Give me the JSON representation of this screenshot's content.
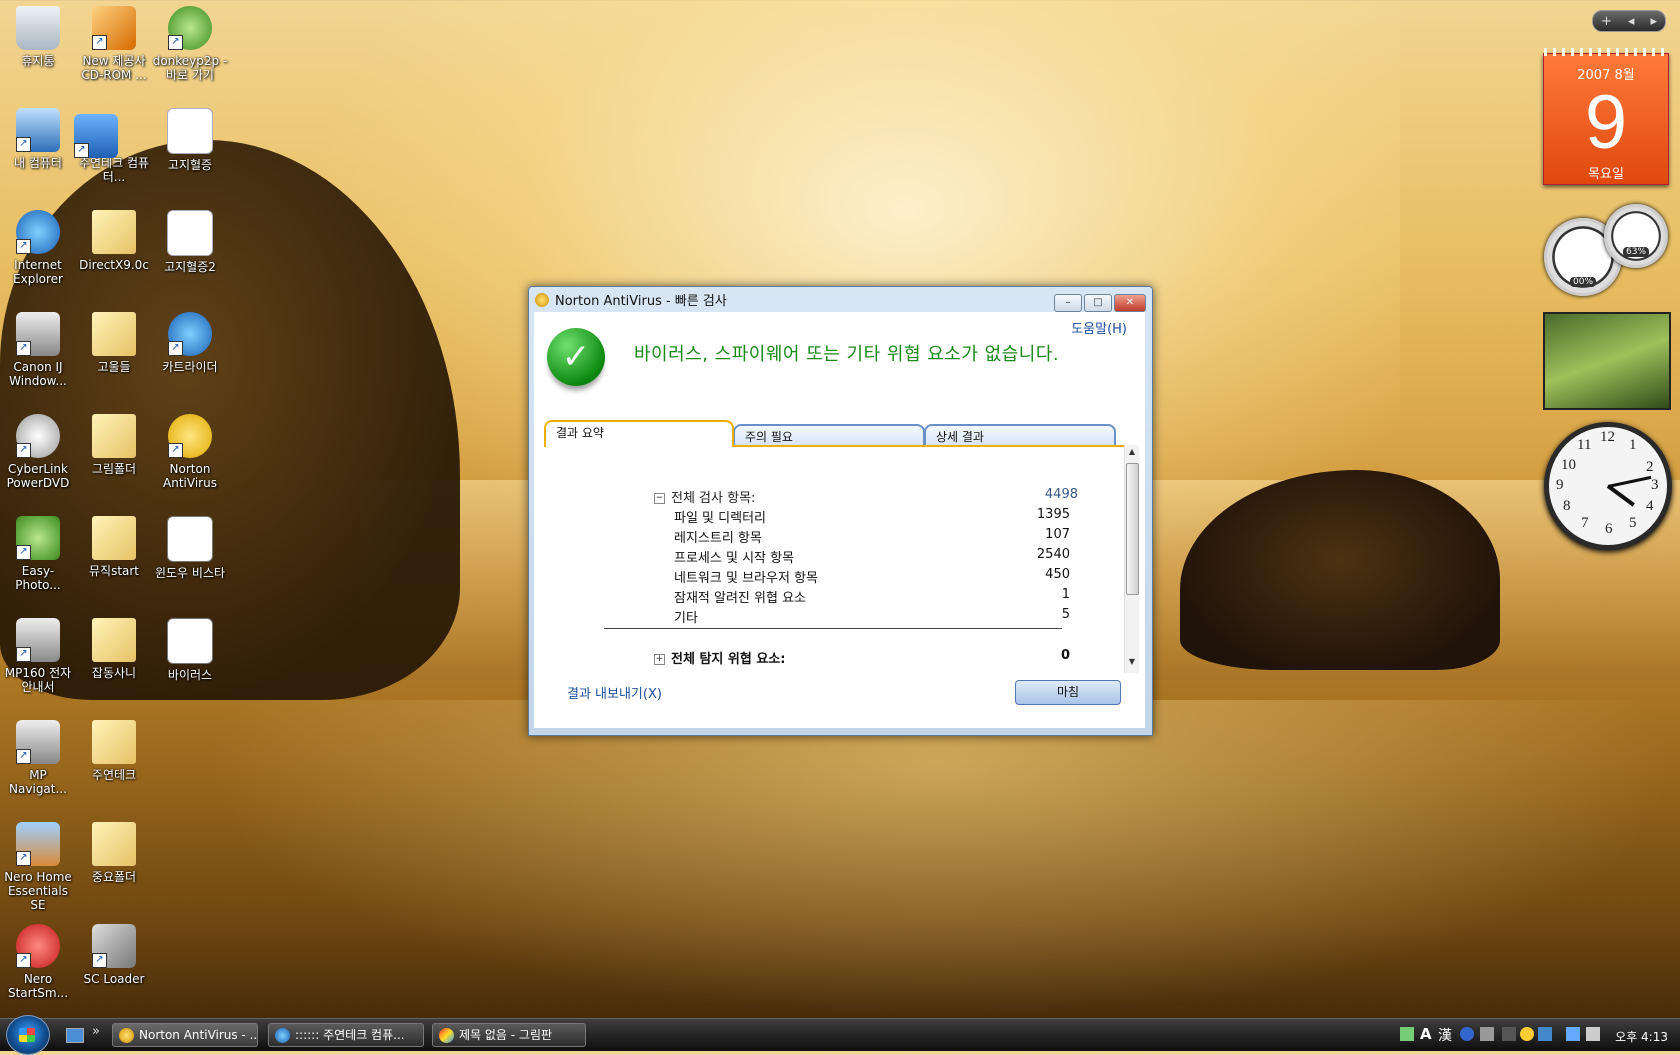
{
  "desktop": {
    "icons": [
      {
        "label": "휴지통"
      },
      {
        "label": "New 제공사 CD-ROM ..."
      },
      {
        "label": "donkeyp2p - 바로 가기"
      },
      {
        "label": "내 컴퓨터"
      },
      {
        "label": "주연테크 컴퓨터..."
      },
      {
        "label": "고지혈증"
      },
      {
        "label": "Internet Explorer"
      },
      {
        "label": "DirectX9.0c"
      },
      {
        "label": "고지혈증2"
      },
      {
        "label": "Canon IJ Window..."
      },
      {
        "label": "고울들"
      },
      {
        "label": "카트라이더"
      },
      {
        "label": "CyberLink PowerDVD"
      },
      {
        "label": "그림폴더"
      },
      {
        "label": "Norton AntiVirus"
      },
      {
        "label": "Easy-Photo..."
      },
      {
        "label": "뮤직start"
      },
      {
        "label": "윈도우 비스타"
      },
      {
        "label": "MP160 전자 안내서"
      },
      {
        "label": "잡동사니"
      },
      {
        "label": "바이러스"
      },
      {
        "label": "MP Navigat..."
      },
      {
        "label": "주연테크"
      },
      {
        "label": "Nero Home Essentials SE"
      },
      {
        "label": "중요폴더"
      },
      {
        "label": "Nero StartSm..."
      },
      {
        "label": "SC Loader"
      }
    ]
  },
  "sidebar": {
    "nav_plus": "+",
    "nav_prev": "◂",
    "nav_next": "▸",
    "calendar": {
      "year_month": "2007 8월",
      "day": "9",
      "weekday": "목요일"
    },
    "meters": {
      "cpu_pct": "00%",
      "mem_pct": "63%"
    },
    "clock": {
      "hour": 4,
      "minute": 13
    }
  },
  "window": {
    "title": "Norton AntiVirus - 빠른 검사",
    "help_link": "도움말(H)",
    "headline": "바이러스, 스파이웨어 또는 기타 위협 요소가 없습니다.",
    "tabs": [
      {
        "label": "결과 요약"
      },
      {
        "label": "주의 필요"
      },
      {
        "label": "상세 결과"
      }
    ],
    "summary": {
      "total_label": "전체 검사 항목:",
      "total_value": "4498",
      "items": [
        {
          "label": "파일 및 디렉터리",
          "value": "1395"
        },
        {
          "label": "레지스트리 항목",
          "value": "107"
        },
        {
          "label": "프로세스 및 시작 항목",
          "value": "2540"
        },
        {
          "label": "네트워크 및 브라우저 항목",
          "value": "450"
        },
        {
          "label": "잠재적 알려진 위협 요소",
          "value": "1"
        },
        {
          "label": "기타",
          "value": "5"
        }
      ],
      "threats_label": "전체 탐지 위협 요소:",
      "threats_value": "0"
    },
    "export_link": "결과 내보내기(X)",
    "finish_button": "마침",
    "ctrl_min": "–",
    "ctrl_max": "□",
    "ctrl_close": "✕",
    "toggle_minus": "−",
    "toggle_plus": "+",
    "scroll_up": "▲",
    "scroll_down": "▼",
    "checkmark": "✓"
  },
  "taskbar": {
    "quicklaunch_more": "»",
    "buttons": [
      {
        "label": "Norton AntiVirus - ..."
      },
      {
        "label": ":::::: 주연테크 컴퓨..."
      },
      {
        "label": "제목 없음 - 그림판"
      }
    ],
    "ime_a": "A",
    "ime_han": "漢",
    "time": "오후 4:13"
  },
  "colors": {
    "headline_green": "#1a8a1a",
    "link_blue": "#1a4e9e",
    "tab_accent": "#f0b000"
  }
}
